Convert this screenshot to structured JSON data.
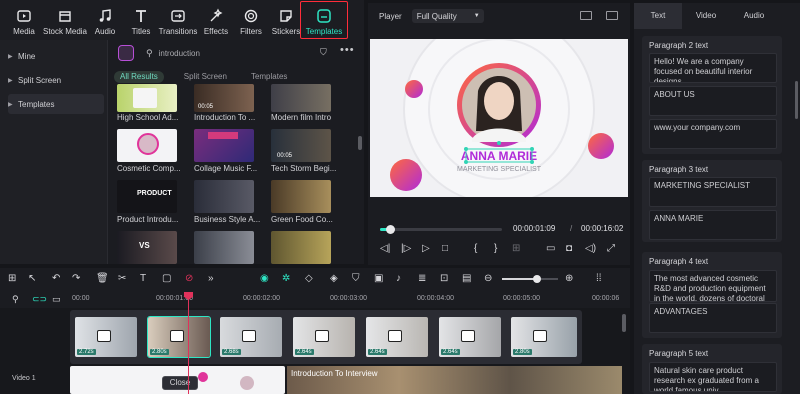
{
  "media_bar": {
    "items": [
      {
        "label": "Media",
        "icon": "media-icon"
      },
      {
        "label": "Stock Media",
        "icon": "stock-media-icon"
      },
      {
        "label": "Audio",
        "icon": "audio-icon"
      },
      {
        "label": "Titles",
        "icon": "titles-icon"
      },
      {
        "label": "Transitions",
        "icon": "transitions-icon"
      },
      {
        "label": "Effects",
        "icon": "effects-icon"
      },
      {
        "label": "Filters",
        "icon": "filters-icon"
      },
      {
        "label": "Stickers",
        "icon": "stickers-icon"
      },
      {
        "label": "Templates",
        "icon": "templates-icon"
      }
    ]
  },
  "categories": [
    "Mine",
    "Split Screen",
    "Templates"
  ],
  "templates": {
    "search_text": "introduction",
    "tabs": [
      "All Results",
      "Split Screen",
      "Templates"
    ],
    "names": [
      "High School Ad...",
      "Introduction To ...",
      "Modern film Intro",
      "Cosmetic Comp...",
      "Collage Music F...",
      "Tech Storm Begi...",
      "Product Introdu...",
      "Business Style A...",
      "Green Food Co..."
    ],
    "thumb_times": [
      "00:05",
      "00:05"
    ]
  },
  "player": {
    "label": "Player",
    "quality": "Full Quality",
    "name_text": "ANNA MARIE",
    "subtitle_text": "MARKETING SPECIALIST",
    "current_time": "00:00:01:09",
    "total_time": "00:00:16:02",
    "progress": 0.08
  },
  "right_panel": {
    "tabs": [
      "Text",
      "Video",
      "Audio"
    ],
    "paragraphs": [
      {
        "title": "Paragraph 2 text",
        "boxes": [
          "Hello! We are a company focused on beautiful interior designs.",
          "ABOUT US",
          "www.your company.com"
        ]
      },
      {
        "title": "Paragraph 3 text",
        "boxes": [
          "MARKETING SPECIALIST",
          "ANNA MARIE"
        ]
      },
      {
        "title": "Paragraph 4 text",
        "boxes": [
          "The most advanced cosmetic R&D and production equipment in the world, dozens of doctoral",
          "ADVANTAGES"
        ]
      },
      {
        "title": "Paragraph 5 text",
        "boxes": [
          "Natural skin care product research ex graduated from a world famous univ"
        ]
      }
    ]
  },
  "timeline": {
    "ruler": [
      "00:00",
      "00:00:01:00",
      "00:00:02:00",
      "00:00:03:00",
      "00:00:04:00",
      "00:00:05:00",
      "00:00:06"
    ],
    "clip_durations": [
      "2.72s",
      "2.80s",
      "2.68s",
      "2.64s",
      "2.64s",
      "2.64s",
      "2.80s"
    ],
    "video_track_label": "Video 1",
    "clip_title": "Introduction To Interview",
    "close_label": "Close",
    "zoom": 0.62
  },
  "colors": {
    "accent": "#2ee6c5",
    "highlight": "#ff2d3a",
    "playhead": "#e0325b",
    "brand_pink": "#e0349a"
  }
}
